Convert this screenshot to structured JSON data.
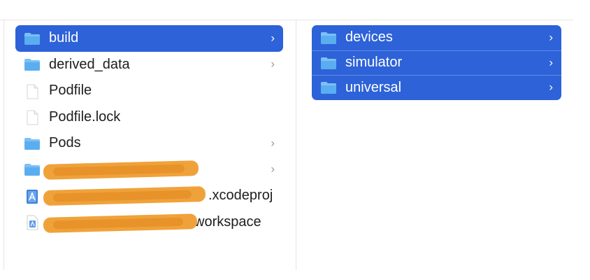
{
  "left_column": {
    "items": [
      {
        "label": "build",
        "icon": "folder-icon",
        "has_chevron": true,
        "selected": true
      },
      {
        "label": "derived_data",
        "icon": "folder-icon",
        "has_chevron": true,
        "selected": false
      },
      {
        "label": "Podfile",
        "icon": "document-icon",
        "has_chevron": false,
        "selected": false
      },
      {
        "label": "Podfile.lock",
        "icon": "document-icon",
        "has_chevron": false,
        "selected": false
      },
      {
        "label": "Pods",
        "icon": "folder-icon",
        "has_chevron": true,
        "selected": false
      },
      {
        "label": "",
        "icon": "folder-icon",
        "has_chevron": true,
        "selected": false,
        "redacted": true
      },
      {
        "label": ".xcodeproj",
        "icon": "xcode-project-icon",
        "has_chevron": false,
        "selected": false,
        "redacted": true
      },
      {
        "label": "workspace",
        "icon": "xcode-workspace-icon",
        "has_chevron": false,
        "selected": false,
        "redacted": true
      }
    ]
  },
  "right_column": {
    "items": [
      {
        "label": "devices",
        "icon": "folder-icon",
        "has_chevron": true
      },
      {
        "label": "simulator",
        "icon": "folder-icon",
        "has_chevron": true
      },
      {
        "label": "universal",
        "icon": "folder-icon",
        "has_chevron": true
      }
    ]
  },
  "chevron_glyph": "›",
  "colors": {
    "selection": "#2d62d8",
    "folder": "#5aaef0",
    "redaction": "#f0a23a"
  }
}
